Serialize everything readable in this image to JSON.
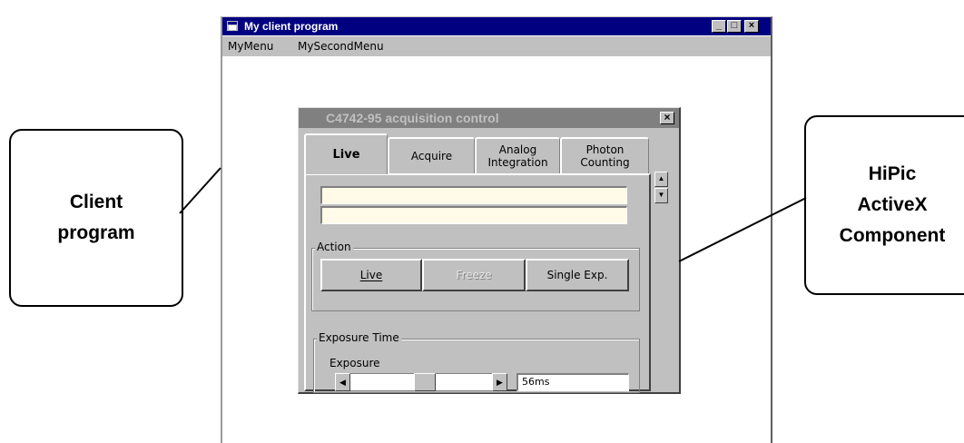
{
  "client_callout": {
    "line1": "Client",
    "line2": "program"
  },
  "component_callout": {
    "line1": "HiPic",
    "line2": "ActiveX",
    "line3": "Component"
  },
  "client_window": {
    "title": "My client program",
    "menus": [
      "MyMenu",
      "MySecondMenu"
    ],
    "caption_buttons": [
      "minimize",
      "maximize",
      "close"
    ]
  },
  "acq_control": {
    "title": "C4742-95 acquisition control",
    "tabs": [
      {
        "label": "Live",
        "active": true
      },
      {
        "label": "Acquire",
        "active": false
      },
      {
        "label": "Analog\nIntegration",
        "active": false
      },
      {
        "label": "Photon\nCounting",
        "active": false
      }
    ],
    "action": {
      "label": "Action",
      "buttons": [
        {
          "label": "Live",
          "mnemonic": "L",
          "enabled": true
        },
        {
          "label": "Freeze",
          "mnemonic": "F",
          "enabled": false
        },
        {
          "label": "Single Exp.",
          "mnemonic": "S",
          "enabled": true
        }
      ]
    },
    "exposure": {
      "group_label": "Exposure Time",
      "label": "Exposure",
      "value": "56ms"
    }
  },
  "colors": {
    "active_titlebar": "#000080",
    "inactive_titlebar": "#808080",
    "face": "#c0c0c0",
    "field_bg": "#fffbe8"
  },
  "icons": [
    "app-icon",
    "minimize-icon",
    "maximize-icon",
    "close-icon",
    "spin-up-icon",
    "spin-down-icon",
    "scroll-left-icon",
    "scroll-right-icon"
  ]
}
